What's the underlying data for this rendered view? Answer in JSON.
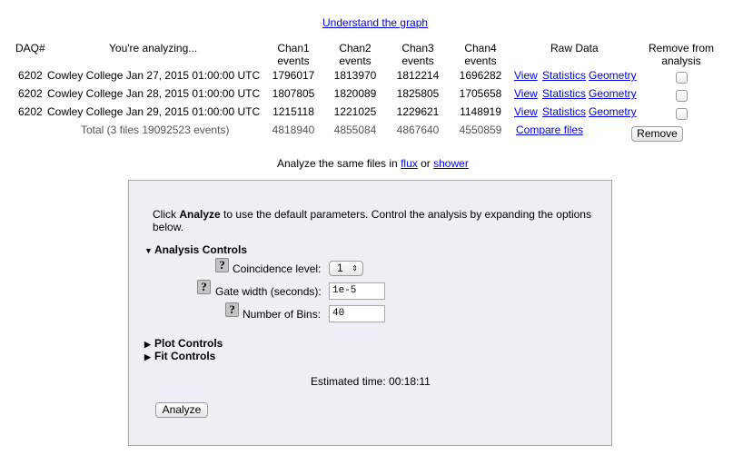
{
  "links": {
    "understand_graph": "Understand the graph",
    "flux": "flux",
    "shower": "shower",
    "compare_files": "Compare files"
  },
  "table": {
    "headers": {
      "daq": "DAQ#",
      "analyzing": "You're analyzing...",
      "chan1": [
        "Chan1",
        "events"
      ],
      "chan2": [
        "Chan2",
        "events"
      ],
      "chan3": [
        "Chan3",
        "events"
      ],
      "chan4": [
        "Chan4",
        "events"
      ],
      "raw_data": "Raw Data",
      "remove": [
        "Remove from",
        "analysis"
      ]
    },
    "rows": [
      {
        "daq": "6202",
        "name": "Cowley College Jan 27, 2015 01:00:00 UTC",
        "chan1": "1796017",
        "chan2": "1813970",
        "chan3": "1812214",
        "chan4": "1696282",
        "view": "View",
        "statistics": "Statistics",
        "geometry": "Geometry"
      },
      {
        "daq": "6202",
        "name": "Cowley College Jan 28, 2015 01:00:00 UTC",
        "chan1": "1807805",
        "chan2": "1820089",
        "chan3": "1825805",
        "chan4": "1705658",
        "view": "View",
        "statistics": "Statistics",
        "geometry": "Geometry"
      },
      {
        "daq": "6202",
        "name": "Cowley College Jan 29, 2015 01:00:00 UTC",
        "chan1": "1215118",
        "chan2": "1221025",
        "chan3": "1229621",
        "chan4": "1148919",
        "view": "View",
        "statistics": "Statistics",
        "geometry": "Geometry"
      }
    ],
    "total": {
      "label": "Total (3 files 19092523 events)",
      "chan1": "4818940",
      "chan2": "4855084",
      "chan3": "4867640",
      "chan4": "4550859"
    },
    "remove_button": "Remove"
  },
  "analyze_same": {
    "prefix": "Analyze the same files in",
    "or": "or"
  },
  "panel": {
    "intro_bold": "Analyze",
    "intro_pre": "Click",
    "intro_post": "to use the default parameters. Control the analysis by expanding the options",
    "intro_line2": "below.",
    "analysis_controls": "Analysis Controls",
    "coincidence_label": "Coincidence level:",
    "coincidence_value": "1",
    "gate_label": "Gate width (seconds):",
    "gate_value": "1e-5",
    "bins_label": "Number of Bins:",
    "bins_value": "40",
    "help_glyph": "?",
    "plot_controls": "Plot Controls",
    "fit_controls": "Fit Controls",
    "estimated_time": "Estimated time: 00:18:11",
    "analyze_button": "Analyze"
  }
}
